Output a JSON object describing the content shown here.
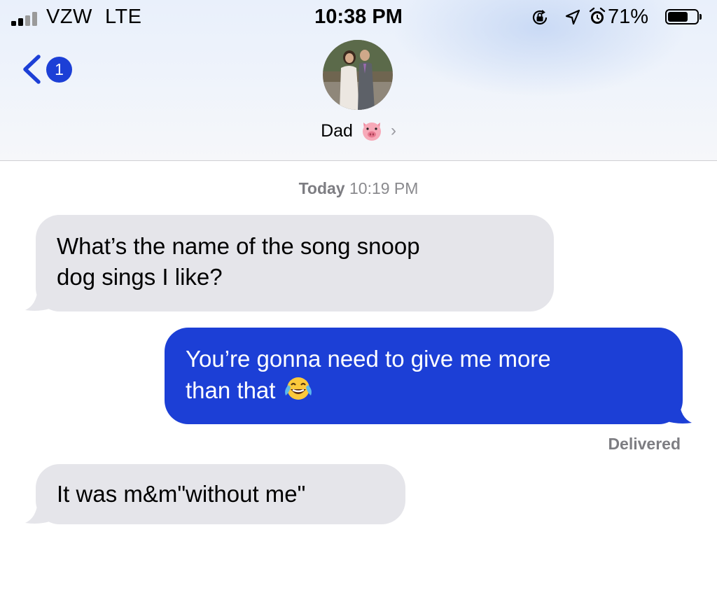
{
  "status_bar": {
    "carrier": "VZW",
    "network": "LTE",
    "time": "10:38 PM",
    "battery_percent": "71%",
    "battery_level": 0.71,
    "icons": [
      "signal-bars-icon",
      "orientation-lock-icon",
      "location-arrow-icon",
      "alarm-icon",
      "battery-icon"
    ]
  },
  "nav": {
    "back_badge_count": "1",
    "contact_name": "Dad",
    "contact_emoji": "pig-face-icon",
    "accent_color": "#1c3fd6"
  },
  "conversation": {
    "timestamp_day": "Today",
    "timestamp_time": "10:19 PM",
    "messages": [
      {
        "direction": "incoming",
        "lines": [
          "What’s the name of the song snoop",
          "dog sings I like?"
        ]
      },
      {
        "direction": "outgoing",
        "lines": [
          "You’re gonna need to give me more",
          "than that"
        ],
        "emoji": "face-with-tears-of-joy-icon"
      },
      {
        "direction": "incoming",
        "lines": [
          "It was m&m\"without me\""
        ]
      }
    ],
    "delivery_status": "Delivered"
  },
  "colors": {
    "incoming_bubble": "#e5e5ea",
    "outgoing_bubble": "#1c3fd6",
    "secondary_text": "#8a8a8e"
  }
}
